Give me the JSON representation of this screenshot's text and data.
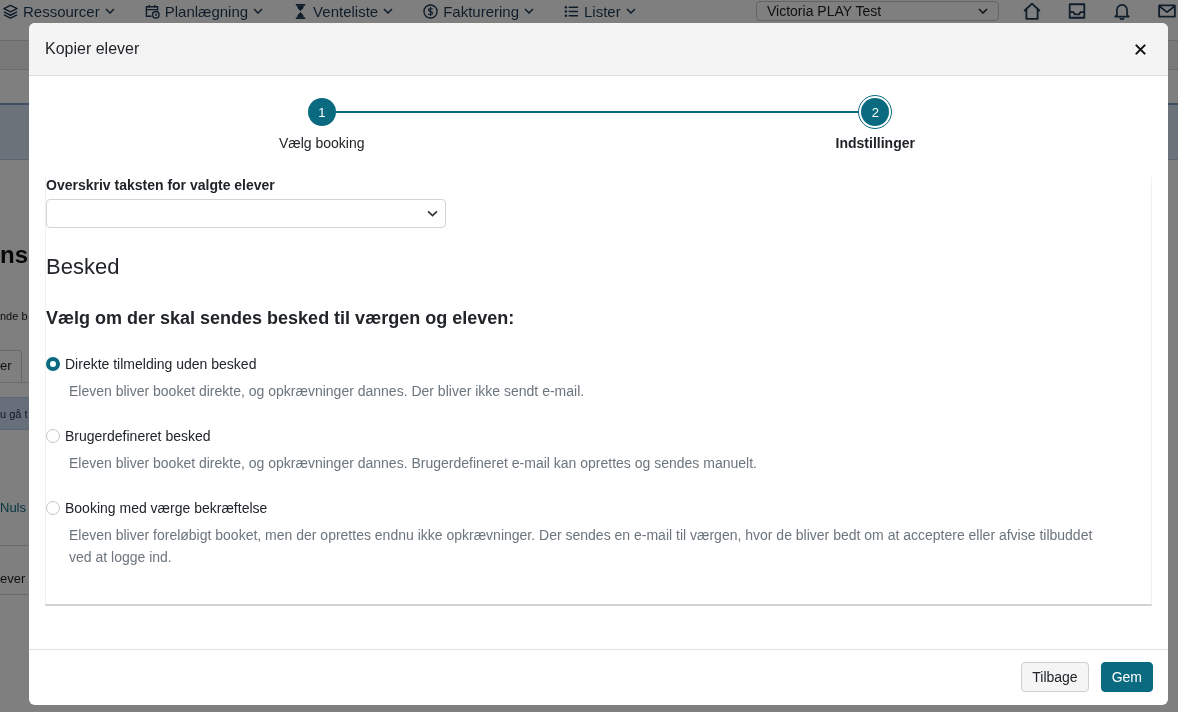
{
  "background_page": {
    "nav": [
      {
        "label": "Ressourcer"
      },
      {
        "label": "Planlægning"
      },
      {
        "label": "Venteliste"
      },
      {
        "label": "Fakturering"
      },
      {
        "label": "Lister"
      }
    ],
    "account_select": {
      "value": "Victoria PLAY Test"
    },
    "left_edge": {
      "heading": "ns",
      "text": "nde b",
      "tab": "er",
      "alert": "u gå t",
      "link": "Nuls",
      "row_text": "ever"
    }
  },
  "dialog": {
    "title": "Kopier elever",
    "steps": [
      {
        "number": "1",
        "label": "Vælg booking",
        "selected": false
      },
      {
        "number": "2",
        "label": "Indstillinger",
        "selected": true
      }
    ],
    "rate_select": {
      "label": "Overskriv taksten for valgte elever"
    },
    "section_title": "Besked",
    "question": "Vælg om der skal sendes besked til værgen og eleven:",
    "options": [
      {
        "label": "Direkte tilmelding uden besked",
        "description": "Eleven bliver booket direkte, og opkrævninger dannes. Der bliver ikke sendt e-mail.",
        "selected": true
      },
      {
        "label": "Brugerdefineret besked",
        "description": "Eleven bliver booket direkte, og opkrævninger dannes. Brugerdefineret e-mail kan oprettes og sendes manuelt.",
        "selected": false
      },
      {
        "label": "Booking med værge bekræftelse",
        "description": "Eleven bliver foreløbigt booket, men der oprettes endnu ikke opkrævninger. Der sendes en e-mail til værgen, hvor de bliver bedt om at acceptere eller afvise tilbuddet ved at logge ind.",
        "selected": false
      }
    ],
    "buttons": [
      {
        "label": "Tilbage",
        "kind": "secondary"
      },
      {
        "label": "Gem",
        "kind": "primary"
      }
    ]
  }
}
